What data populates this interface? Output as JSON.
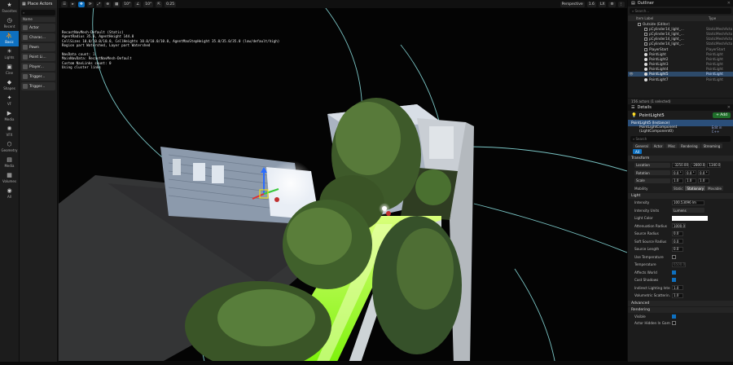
{
  "left_toolbar": {
    "items": [
      {
        "label": "Favorites",
        "icon": "star-icon",
        "glyph": "★"
      },
      {
        "label": "Recent",
        "icon": "clock-icon",
        "glyph": "◷"
      },
      {
        "label": "Basic",
        "icon": "person-icon",
        "glyph": "⛹"
      },
      {
        "label": "Lights",
        "icon": "bulb-icon",
        "glyph": "☀"
      },
      {
        "label": "Cine",
        "icon": "camera-icon",
        "glyph": "▣"
      },
      {
        "label": "Shapes",
        "icon": "cube-icon",
        "glyph": "◆"
      },
      {
        "label": "VF",
        "icon": "effects-icon",
        "glyph": "✦"
      },
      {
        "label": "Media",
        "icon": "media-icon",
        "glyph": "▶"
      },
      {
        "label": "VFX",
        "icon": "vfx-icon",
        "glyph": "✺"
      },
      {
        "label": "Geometry",
        "icon": "geometry-icon",
        "glyph": "⬡"
      },
      {
        "label": "Media",
        "icon": "media-icon",
        "glyph": "▤"
      },
      {
        "label": "Volumes",
        "icon": "volume-icon",
        "glyph": "▦"
      },
      {
        "label": "All",
        "icon": "all-icon",
        "glyph": "◉"
      }
    ]
  },
  "place_actors": {
    "title": "Place Actors",
    "column": "Name",
    "items": [
      "Actor",
      "Charac...",
      "Pawn",
      "Point Li...",
      "Player...",
      "Trigger...",
      "Trigger..."
    ]
  },
  "viewport_toolbar": {
    "tools": [
      "☰",
      "▸",
      "✥",
      "⟳",
      "⤢",
      "⊕",
      "▦",
      "10°",
      "∠",
      "10°",
      "⇱",
      "0.25"
    ],
    "perspective": "Perspective",
    "right_tools": [
      "1.6",
      "LX",
      "⚙",
      "⋮"
    ]
  },
  "overlay": {
    "lines": [
      "RecastNavMesh-Default (Static)",
      "AgentRadius 35.0, AgentHeight 144.0",
      "CellSizes 10.0/10.0/10.0, CellHeights 10.0/10.0/10.0, AgentMaxStepHeight 35.0/35.0/35.0 (low/default/high)",
      "Region part Watershed, Layer part Watershed",
      "",
      "NavData count: 1",
      "MainNavData: RecastNavMesh-Default",
      "Custom NavLinks count: 0",
      "Using cluster links"
    ]
  },
  "outliner": {
    "title": "Outliner",
    "search_placeholder": "Search...",
    "col_label": "Item Label",
    "col_type": "Type",
    "rows": [
      {
        "name": "Outside (Editor)",
        "type": ""
      },
      {
        "name": "pCylinder14_light_...",
        "type": "StaticMeshActo"
      },
      {
        "name": "pCylinder14_light_...",
        "type": "StaticMeshActo"
      },
      {
        "name": "pCylinder14_light_...",
        "type": "StaticMeshActo"
      },
      {
        "name": "pCylinder14_light_...",
        "type": "StaticMeshActo"
      },
      {
        "name": "PlayerStart",
        "type": "PlayerStart"
      },
      {
        "name": "PointLight",
        "type": "PointLight"
      },
      {
        "name": "PointLight2",
        "type": "PointLight"
      },
      {
        "name": "PointLight3",
        "type": "PointLight"
      },
      {
        "name": "PointLight4",
        "type": "PointLight"
      },
      {
        "name": "PointLight5",
        "type": "PointLight"
      },
      {
        "name": "PointLight7",
        "type": "PointLight"
      }
    ],
    "footer": "156 actors (1 selected)"
  },
  "details": {
    "title": "Details",
    "actor": "PointLight5",
    "add_label": "+ Add",
    "components": [
      {
        "name": "PointLight5 (Instance)",
        "edit": ""
      },
      {
        "name": "PointLightComponent (LightComponent0)",
        "edit": "Edit in C++"
      }
    ],
    "search_placeholder": "Search",
    "filters": [
      "General",
      "Actor",
      "Misc",
      "Rendering",
      "Streaming",
      "All"
    ],
    "transform_section": "Transform",
    "location": {
      "label": "Location",
      "x": "-3250.00",
      "y": "-2800.0",
      "z": "1340.0"
    },
    "rotation": {
      "label": "Rotation",
      "x": "0.0 °",
      "y": "0.0 °",
      "z": "0.0 °"
    },
    "scale": {
      "label": "Scale",
      "x": "1.0",
      "y": "1.0",
      "z": "1.0"
    },
    "mobility": {
      "label": "Mobility",
      "options": [
        "Static",
        "Stationary",
        "Movable"
      ]
    },
    "light_section": "Light",
    "intensity": {
      "label": "Intensity",
      "value": "100.53096 lm"
    },
    "intensity_units": {
      "label": "Intensity Units",
      "value": "Lumens"
    },
    "light_color": {
      "label": "Light Color"
    },
    "attenuation": {
      "label": "Attenuation Radius",
      "value": "1000.0"
    },
    "source_radius": {
      "label": "Source Radius",
      "value": "0.0"
    },
    "soft_source": {
      "label": "Soft Source Radius",
      "value": "0.0"
    },
    "source_length": {
      "label": "Source Length",
      "value": "0.0"
    },
    "use_temp": {
      "label": "Use Temperature"
    },
    "temperature": {
      "label": "Temperature",
      "value": "6500.0"
    },
    "affects_world": {
      "label": "Affects World"
    },
    "cast_shadows": {
      "label": "Cast Shadows"
    },
    "indirect": {
      "label": "Indirect Lighting Inte...",
      "value": "1.0"
    },
    "volumetric": {
      "label": "Volumetric Scatterin...",
      "value": "1.0"
    },
    "advanced_section": "Advanced",
    "rendering_section": "Rendering",
    "visible": {
      "label": "Visible"
    },
    "actor_hidden": {
      "label": "Actor Hidden In Game"
    }
  }
}
